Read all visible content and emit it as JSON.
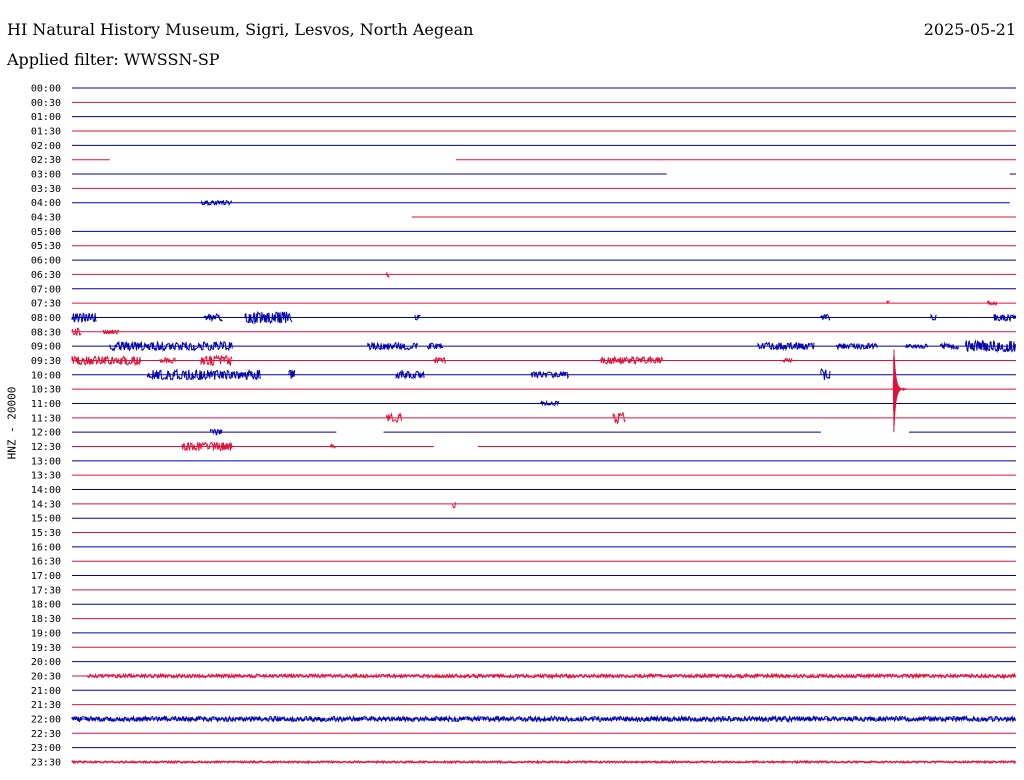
{
  "header": {
    "station": "HI Natural History Museum, Sigri, Lesvos, North Aegean",
    "date": "2025-05-21",
    "filter": "Applied filter: WWSSN-SP"
  },
  "colors": {
    "trace_even": "#0000aa",
    "trace_odd": "#e0103a",
    "background": "#ffffff",
    "text": "#000000"
  },
  "chart_data": {
    "type": "line",
    "title": "HI Natural History Museum, Sigri, Lesvos, North Aegean",
    "ylabel": "HNZ - 20000",
    "xlabel": "",
    "grid": false,
    "legend": "none",
    "row_labels": [
      "00:00",
      "00:30",
      "01:00",
      "01:30",
      "02:00",
      "02:30",
      "03:00",
      "03:30",
      "04:00",
      "04:30",
      "05:00",
      "05:30",
      "06:00",
      "06:30",
      "07:00",
      "07:30",
      "08:00",
      "08:30",
      "09:00",
      "09:30",
      "10:00",
      "10:30",
      "11:00",
      "11:30",
      "12:00",
      "12:30",
      "13:00",
      "13:30",
      "14:00",
      "14:30",
      "15:00",
      "15:30",
      "16:00",
      "16:30",
      "17:00",
      "17:30",
      "18:00",
      "18:30",
      "19:00",
      "19:30",
      "20:00",
      "20:30",
      "21:00",
      "21:30",
      "22:00",
      "22:30",
      "23:00",
      "23:30"
    ],
    "x_range_min": [
      0,
      30
    ],
    "gaps_min": [
      {
        "row": 5,
        "from": 1.2,
        "to": 12.2
      },
      {
        "row": 6,
        "from": 18.9,
        "to": 29.8
      },
      {
        "row": 8,
        "from": 29.8,
        "to": 30
      },
      {
        "row": 9,
        "from": 0,
        "to": 10.8
      },
      {
        "row": 24,
        "from": 8.4,
        "to": 9.9
      },
      {
        "row": 24,
        "from": 23.8,
        "to": 26.6
      },
      {
        "row": 25,
        "from": 11.5,
        "to": 12.9
      }
    ],
    "activity": [
      {
        "row": 8,
        "from": 4.1,
        "to": 5.1,
        "amp": 0.3
      },
      {
        "row": 13,
        "from": 10.0,
        "to": 10.1,
        "amp": 0.4
      },
      {
        "row": 15,
        "from": 25.9,
        "to": 26.0,
        "amp": 0.4
      },
      {
        "row": 15,
        "from": 29.1,
        "to": 29.4,
        "amp": 0.3
      },
      {
        "row": 16,
        "from": 0.0,
        "to": 0.8,
        "amp": 0.6
      },
      {
        "row": 16,
        "from": 4.2,
        "to": 4.8,
        "amp": 0.5
      },
      {
        "row": 16,
        "from": 5.5,
        "to": 7.0,
        "amp": 0.8
      },
      {
        "row": 16,
        "from": 10.9,
        "to": 11.1,
        "amp": 0.4
      },
      {
        "row": 16,
        "from": 23.8,
        "to": 24.1,
        "amp": 0.4
      },
      {
        "row": 16,
        "from": 27.3,
        "to": 27.5,
        "amp": 0.4
      },
      {
        "row": 16,
        "from": 29.3,
        "to": 30.0,
        "amp": 0.5
      },
      {
        "row": 17,
        "from": 0.0,
        "to": 0.3,
        "amp": 0.5
      },
      {
        "row": 17,
        "from": 1.0,
        "to": 1.5,
        "amp": 0.3
      },
      {
        "row": 18,
        "from": 1.2,
        "to": 5.1,
        "amp": 0.6
      },
      {
        "row": 18,
        "from": 9.4,
        "to": 11.0,
        "amp": 0.5
      },
      {
        "row": 18,
        "from": 11.3,
        "to": 11.8,
        "amp": 0.4
      },
      {
        "row": 18,
        "from": 21.8,
        "to": 23.6,
        "amp": 0.5
      },
      {
        "row": 18,
        "from": 24.3,
        "to": 25.6,
        "amp": 0.4
      },
      {
        "row": 18,
        "from": 26.5,
        "to": 27.2,
        "amp": 0.3
      },
      {
        "row": 18,
        "from": 27.6,
        "to": 28.2,
        "amp": 0.4
      },
      {
        "row": 18,
        "from": 28.4,
        "to": 30.0,
        "amp": 0.8
      },
      {
        "row": 19,
        "from": 0.0,
        "to": 2.2,
        "amp": 0.6
      },
      {
        "row": 19,
        "from": 2.8,
        "to": 3.3,
        "amp": 0.4
      },
      {
        "row": 19,
        "from": 4.1,
        "to": 5.1,
        "amp": 0.7
      },
      {
        "row": 19,
        "from": 11.5,
        "to": 11.9,
        "amp": 0.4
      },
      {
        "row": 19,
        "from": 16.8,
        "to": 18.8,
        "amp": 0.5
      },
      {
        "row": 19,
        "from": 22.6,
        "to": 22.9,
        "amp": 0.3
      },
      {
        "row": 20,
        "from": 2.4,
        "to": 6.0,
        "amp": 0.7
      },
      {
        "row": 20,
        "from": 6.9,
        "to": 7.1,
        "amp": 0.8
      },
      {
        "row": 20,
        "from": 10.3,
        "to": 11.2,
        "amp": 0.5
      },
      {
        "row": 20,
        "from": 14.6,
        "to": 15.8,
        "amp": 0.4
      },
      {
        "row": 20,
        "from": 23.8,
        "to": 24.1,
        "amp": 0.8
      },
      {
        "row": 22,
        "from": 14.9,
        "to": 15.5,
        "amp": 0.3
      },
      {
        "row": 23,
        "from": 10.0,
        "to": 10.5,
        "amp": 0.6
      },
      {
        "row": 23,
        "from": 17.2,
        "to": 17.6,
        "amp": 0.8
      },
      {
        "row": 24,
        "from": 4.4,
        "to": 4.8,
        "amp": 0.4
      },
      {
        "row": 25,
        "from": 3.5,
        "to": 5.1,
        "amp": 0.6
      },
      {
        "row": 25,
        "from": 8.2,
        "to": 8.4,
        "amp": 0.3
      },
      {
        "row": 29,
        "from": 12.1,
        "to": 12.2,
        "amp": 0.6
      },
      {
        "row": 41,
        "from": 0.5,
        "to": 30.0,
        "amp": 0.25
      },
      {
        "row": 44,
        "from": 0.0,
        "to": 30.0,
        "amp": 0.35
      },
      {
        "row": 47,
        "from": 0.0,
        "to": 30.0,
        "amp": 0.15
      }
    ],
    "events": [
      {
        "row": 21,
        "minute": 26.1,
        "peak_amp": 3.0
      }
    ],
    "trace_units": "counts",
    "amplitude_units": "relative to row spacing"
  }
}
